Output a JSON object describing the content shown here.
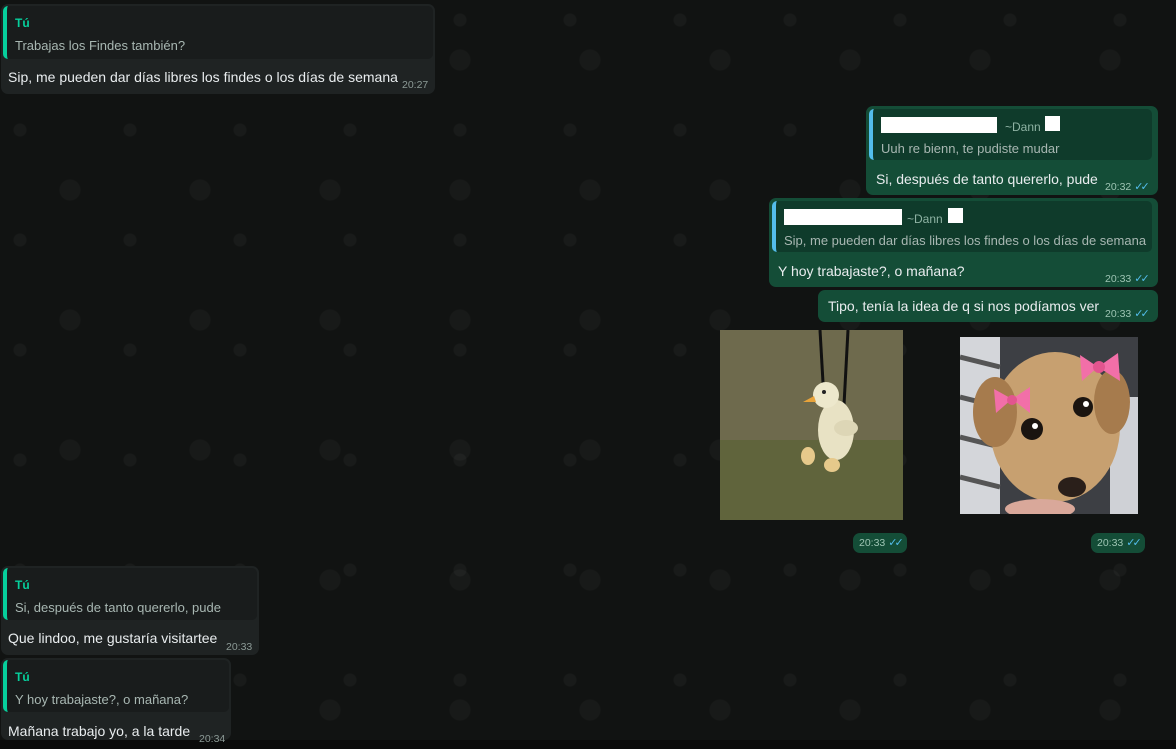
{
  "messages": [
    {
      "id": "m1",
      "dir": "in",
      "quote_author": "Tú",
      "quote_text": "Trabajas los Findes también?",
      "text": "Sip, me pueden dar días libres los findes o los días de semana",
      "time": "20:27"
    },
    {
      "id": "m2",
      "dir": "out",
      "quote_contact": "~Dann",
      "quote_text": "Uuh re bienn, te pudiste mudar",
      "text": "Si, después de tanto quererlo, pude",
      "time": "20:32"
    },
    {
      "id": "m3",
      "dir": "out",
      "quote_contact": "~Dann",
      "quote_text": "Sip, me pueden dar días libres los findes o los días de semana",
      "text": "Y hoy trabajaste?, o mañana?",
      "time": "20:33"
    },
    {
      "id": "m4",
      "dir": "out",
      "text": "Tipo, tenía la idea de q si nos podíamos ver",
      "time": "20:33"
    },
    {
      "id": "m5",
      "dir": "out",
      "type": "image",
      "image": "duck-keychain-photo",
      "time": "20:33"
    },
    {
      "id": "m6",
      "dir": "out",
      "type": "image",
      "image": "puppy-with-bows-photo",
      "time": "20:33"
    },
    {
      "id": "m7",
      "dir": "in",
      "quote_author": "Tú",
      "quote_text": "Si, después de tanto quererlo, pude",
      "text": "Que lindoo, me gustaría visitartee",
      "time": "20:33"
    },
    {
      "id": "m8",
      "dir": "in",
      "quote_author": "Tú",
      "quote_text": "Y hoy trabajaste?, o mañana?",
      "text": "Mañana trabajo yo, a la tarde",
      "time": "20:34"
    }
  ],
  "tick_glyph": "✓✓",
  "colors": {
    "incoming": "#1f2323",
    "outgoing": "#144d37",
    "accent": "#06cf9c",
    "read_ticks": "#53bdeb"
  }
}
